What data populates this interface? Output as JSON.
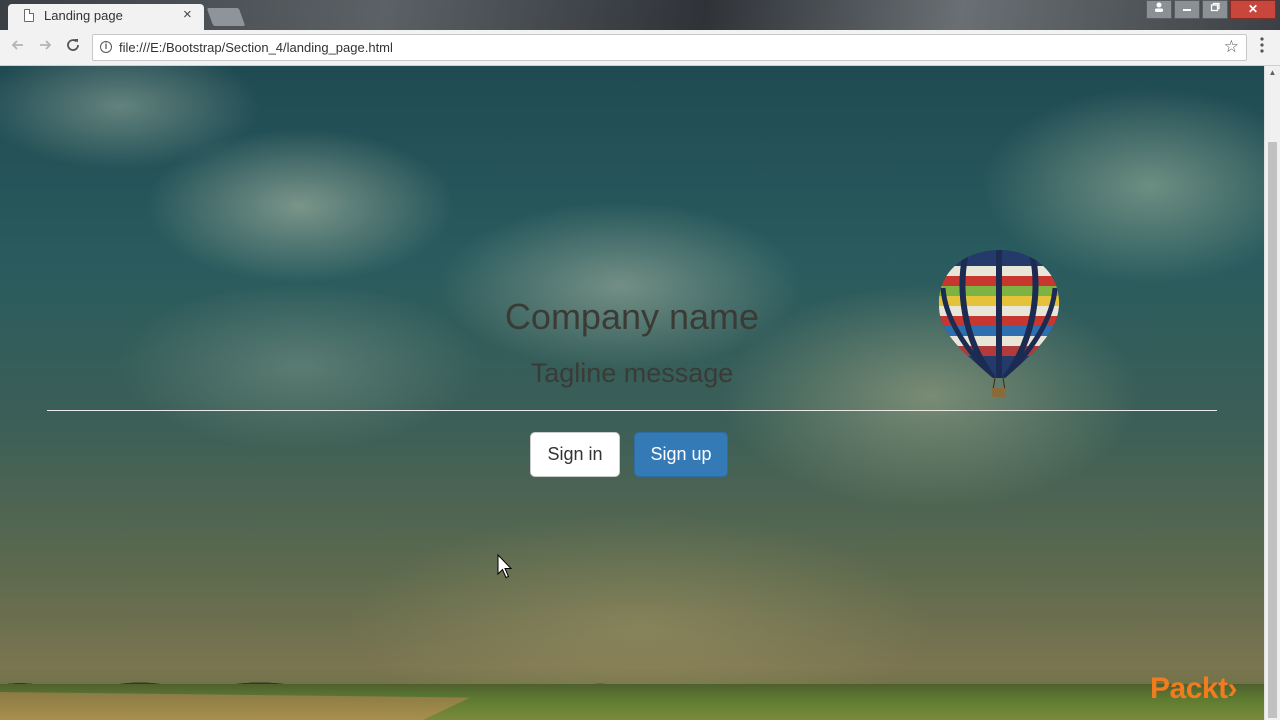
{
  "browser": {
    "tab_title": "Landing page",
    "tab_close": "×",
    "url": "file:///E:/Bootstrap/Section_4/landing_page.html",
    "window_controls": {
      "close": "✕"
    }
  },
  "page": {
    "company_name": "Company name",
    "tagline": "Tagline message",
    "signin_label": "Sign in",
    "signup_label": "Sign up"
  },
  "watermark": {
    "text": "Packt›"
  },
  "colors": {
    "signup_button": "#337ab7",
    "watermark": "#f07c1f"
  },
  "icons": {
    "back": "arrow-left-icon",
    "forward": "arrow-right-icon",
    "reload": "reload-icon",
    "info": "info-icon",
    "bookmark": "star-icon",
    "menu": "more-vertical-icon"
  }
}
